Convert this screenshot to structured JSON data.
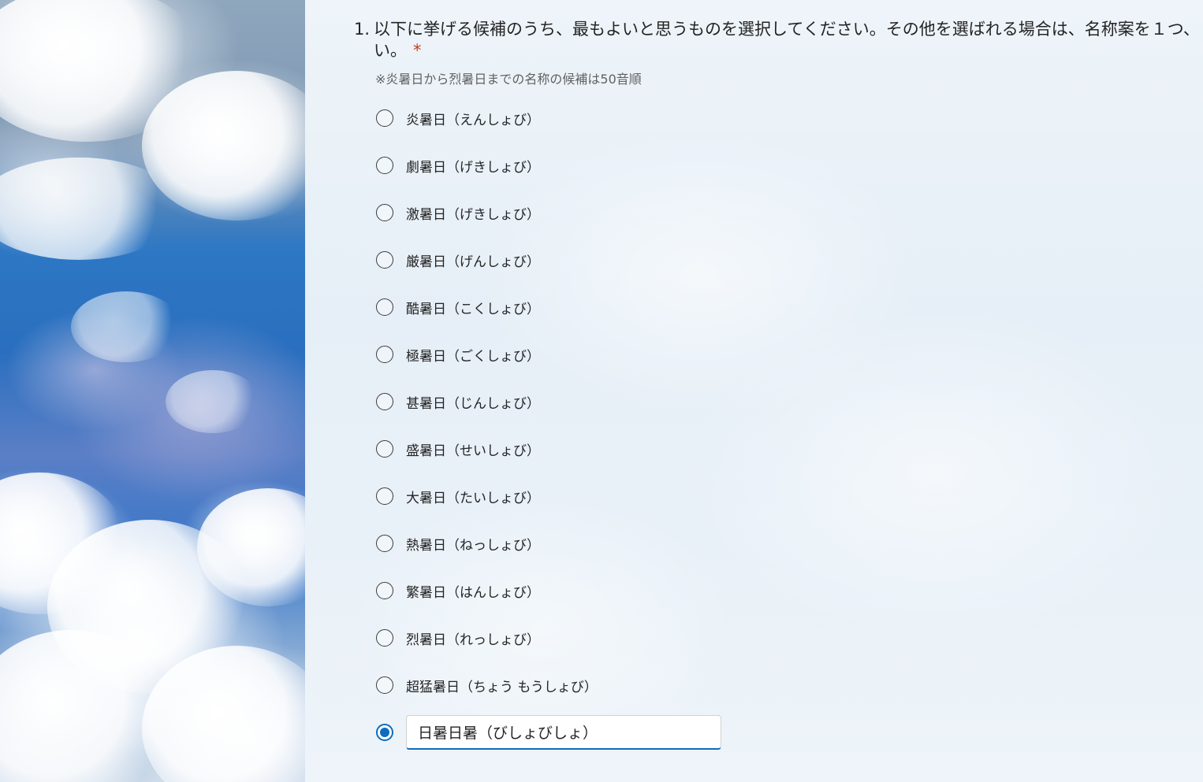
{
  "question": {
    "number": "1.",
    "text": "以下に挙げる候補のうち、最もよいと思うものを選択してください。その他を選ばれる場合は、名称案を１つ、",
    "text_line2": "い。",
    "required_mark": "*",
    "note": "※炎暑日から烈暑日までの名称の候補は50音順"
  },
  "options": [
    {
      "label": "炎暑日（えんしょび）",
      "selected": false
    },
    {
      "label": "劇暑日（げきしょび）",
      "selected": false
    },
    {
      "label": "激暑日（げきしょび）",
      "selected": false
    },
    {
      "label": "厳暑日（げんしょび）",
      "selected": false
    },
    {
      "label": "酷暑日（こくしょび）",
      "selected": false
    },
    {
      "label": "極暑日（ごくしょび）",
      "selected": false
    },
    {
      "label": "甚暑日（じんしょび）",
      "selected": false
    },
    {
      "label": "盛暑日（せいしょび）",
      "selected": false
    },
    {
      "label": "大暑日（たいしょび）",
      "selected": false
    },
    {
      "label": "熱暑日（ねっしょび）",
      "selected": false
    },
    {
      "label": "繁暑日（はんしょび）",
      "selected": false
    },
    {
      "label": "烈暑日（れっしょび）",
      "selected": false
    },
    {
      "label": "超猛暑日（ちょう もうしょび）",
      "selected": false
    }
  ],
  "other_option": {
    "selected": true,
    "value": "日暑日暑（びしょびしょ）"
  },
  "colors": {
    "accent": "#0f6cbd",
    "required": "#c43e1c",
    "text": "#242424",
    "note": "#616161"
  }
}
